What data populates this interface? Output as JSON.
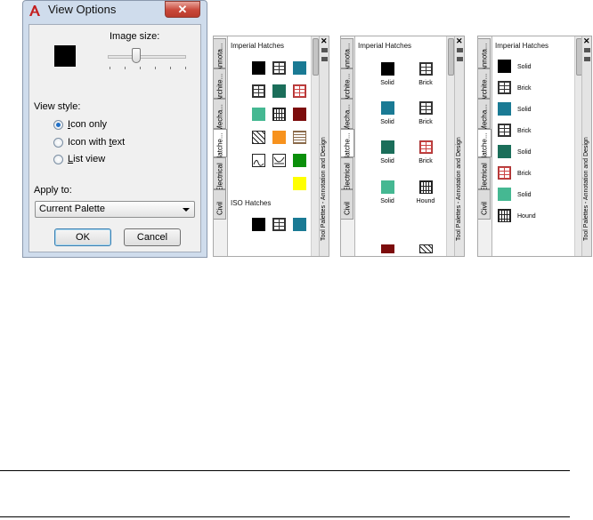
{
  "dialog": {
    "title": "View Options",
    "close_label": "✕",
    "image_size_label": "Image size:",
    "view_style_label": "View style:",
    "options": [
      "Icon only",
      "Icon with text",
      "List view"
    ],
    "selected_option": "Icon only",
    "apply_to_label": "Apply to:",
    "apply_to_value": "Current Palette",
    "ok_label": "OK",
    "cancel_label": "Cancel",
    "image_size_level": 0.33
  },
  "palette": {
    "tabs": [
      "Annota...",
      "Archite...",
      "Mecha...",
      "Hatche...",
      "Electrical",
      "Civil"
    ],
    "active_tab": "Hatche...",
    "vertical_title": "Tool Palettes - Annotation and Design",
    "section_imperial": "Imperial Hatches",
    "section_iso": "ISO Hatches",
    "item_labels": {
      "solid": "Solid",
      "brick": "Brick",
      "hound": "Hound"
    }
  },
  "colors": {
    "teal": "#1a7a94",
    "green": "#1b6e5a",
    "mint": "#45b892",
    "red": "#7c0c0c",
    "orange": "#f7921d",
    "yellow": "#ffff00"
  }
}
